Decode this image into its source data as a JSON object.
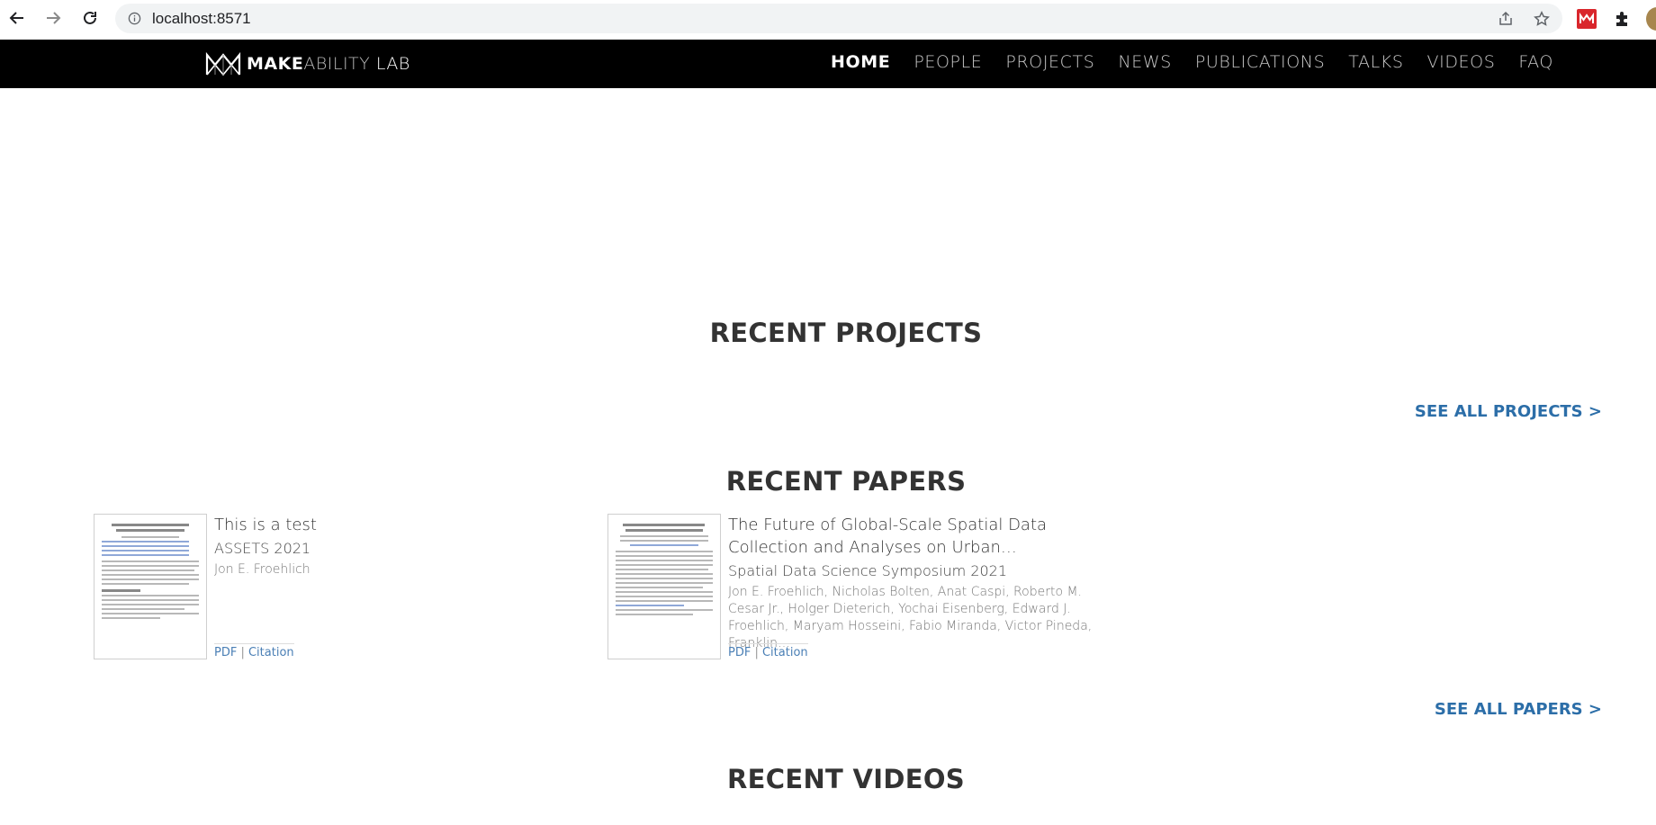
{
  "browser": {
    "url": "localhost:8571"
  },
  "site": {
    "logo": {
      "make": "MAKE",
      "ability": "ABILITY",
      "lab": " LAB"
    },
    "nav": [
      {
        "label": "HOME",
        "active": true
      },
      {
        "label": "PEOPLE",
        "active": false
      },
      {
        "label": "PROJECTS",
        "active": false
      },
      {
        "label": "NEWS",
        "active": false
      },
      {
        "label": "PUBLICATIONS",
        "active": false
      },
      {
        "label": "TALKS",
        "active": false
      },
      {
        "label": "VIDEOS",
        "active": false
      },
      {
        "label": "FAQ",
        "active": false
      }
    ]
  },
  "sections": {
    "projects": {
      "title": "RECENT PROJECTS",
      "see_all": "SEE ALL PROJECTS >"
    },
    "papers": {
      "title": "RECENT PAPERS",
      "see_all": "SEE ALL PAPERS >"
    },
    "videos": {
      "title": "RECENT VIDEOS"
    }
  },
  "papers": [
    {
      "title": "This is a test",
      "venue": "ASSETS 2021",
      "authors": "Jon E. Froehlich",
      "pdf_label": "PDF",
      "separator": " | ",
      "citation_label": "Citation"
    },
    {
      "title": "The Future of Global-Scale Spatial Data Collection and Analyses on Urban…",
      "venue": "Spatial Data Science Symposium 2021",
      "authors": "Jon E. Froehlich, Nicholas Bolten, Anat Caspi, Roberto M. Cesar Jr., Holger Dieterich, Yochai Eisenberg, Edward J. Froehlich, Maryam Hosseini, Fabio Miranda, Victor Pineda, Franklin…",
      "pdf_label": "PDF",
      "separator": " | ",
      "citation_label": "Citation"
    }
  ],
  "colors": {
    "nav_bg": "#000000",
    "link_blue": "#2c6ea8",
    "heading": "#333333"
  }
}
